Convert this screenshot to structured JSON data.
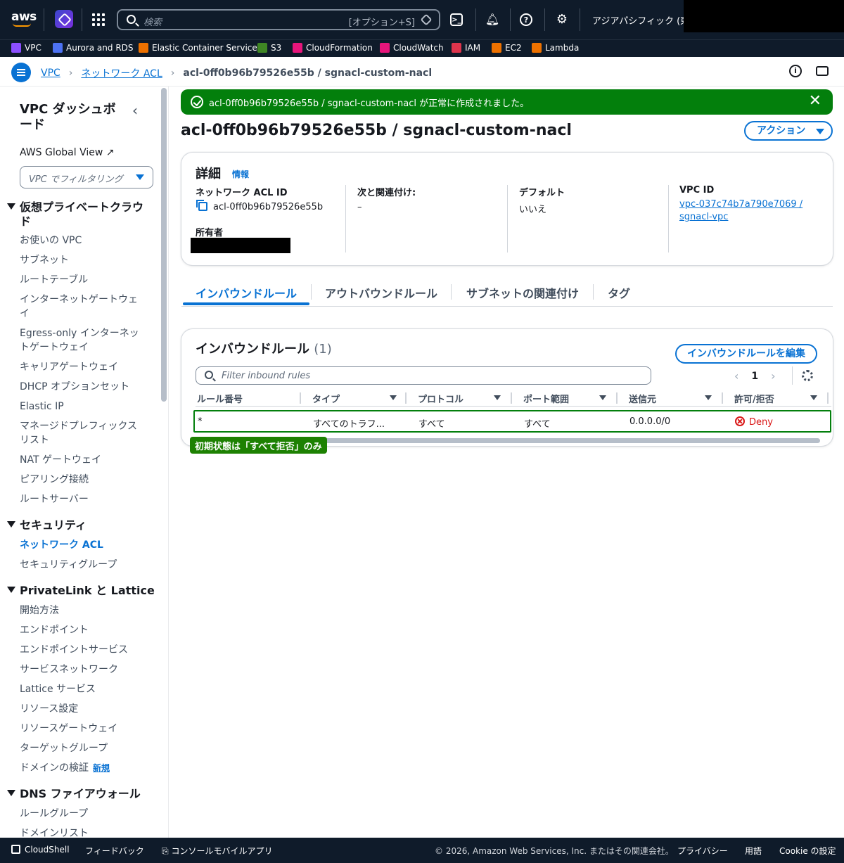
{
  "topnav": {
    "logo": "aws",
    "search_placeholder": "検索",
    "search_hint": "[オプション+S]",
    "region": "アジアパシフィック (東京)"
  },
  "favorites": [
    {
      "label": "VPC",
      "color": "#8c4fff"
    },
    {
      "label": "Aurora and RDS",
      "color": "#4d72f3"
    },
    {
      "label": "Elastic Container Service",
      "color": "#ed7100"
    },
    {
      "label": "S3",
      "color": "#3f8624"
    },
    {
      "label": "CloudFormation",
      "color": "#e7157b"
    },
    {
      "label": "CloudWatch",
      "color": "#e7157b"
    },
    {
      "label": "IAM",
      "color": "#dd344c"
    },
    {
      "label": "EC2",
      "color": "#ed7100"
    },
    {
      "label": "Lambda",
      "color": "#ed7100"
    }
  ],
  "breadcrumb": {
    "items": [
      "VPC",
      "ネットワーク ACL"
    ],
    "current": "acl-0ff0b96b79526e55b / sgnacl-custom-nacl"
  },
  "sidebar": {
    "title": "VPC ダッシュボード",
    "global_view": "AWS Global View",
    "filter_placeholder": "VPC でフィルタリング",
    "sections": [
      {
        "title": "仮想プライベートクラウド",
        "items": [
          "お使いの VPC",
          "サブネット",
          "ルートテーブル",
          "インターネットゲートウェイ",
          "Egress-only インターネットゲートウェイ",
          "キャリアゲートウェイ",
          "DHCP オプションセット",
          "Elastic IP",
          "マネージドプレフィックスリスト",
          "NAT ゲートウェイ",
          "ピアリング接続",
          "ルートサーバー"
        ]
      },
      {
        "title": "セキュリティ",
        "items": [
          "ネットワーク ACL",
          "セキュリティグループ"
        ]
      },
      {
        "title": "PrivateLink と Lattice",
        "items": [
          "開始方法",
          "エンドポイント",
          "エンドポイントサービス",
          "サービスネットワーク",
          "Lattice サービス",
          "リソース設定",
          "リソースゲートウェイ",
          "ターゲットグループ",
          "ドメインの検証"
        ]
      },
      {
        "title": "DNS ファイアウォール",
        "items": [
          "ルールグループ",
          "ドメインリスト"
        ]
      }
    ],
    "new_badge": "新規"
  },
  "flash": {
    "message": "acl-0ff0b96b79526e55b / sgnacl-custom-nacl が正常に作成されました。",
    "color": "#037f0c"
  },
  "page": {
    "title": "acl-0ff0b96b79526e55b / sgnacl-custom-nacl",
    "action_label": "アクション"
  },
  "details": {
    "heading": "詳細",
    "info": "情報",
    "acl_id_label": "ネットワーク ACL ID",
    "acl_id": "acl-0ff0b96b79526e55b",
    "owner_label": "所有者",
    "assoc_label": "次と関連付け:",
    "assoc_value": "–",
    "default_label": "デフォルト",
    "default_value": "いいえ",
    "vpc_label": "VPC ID",
    "vpc_value_1": "vpc-037c74b7a790e7069 /",
    "vpc_value_2": "sgnacl-vpc"
  },
  "tabs": [
    "インバウンドルール",
    "アウトバウンドルール",
    "サブネットの関連付け",
    "タグ"
  ],
  "rules": {
    "heading": "インバウンドルール",
    "count": "(1)",
    "edit_label": "インバウンドルールを編集",
    "filter_placeholder": "Filter inbound rules",
    "page": "1",
    "columns": [
      "ルール番号",
      "タイプ",
      "プロトコル",
      "ポート範囲",
      "送信元",
      "許可/拒否"
    ],
    "rows": [
      {
        "rule": "*",
        "type": "すべてのトラフ...",
        "protocol": "すべて",
        "port": "すべて",
        "source": "0.0.0.0/0",
        "action": "Deny"
      }
    ]
  },
  "annotation": "初期状態は「すべて拒否」のみ",
  "footer": {
    "cloudshell": "CloudShell",
    "feedback": "フィードバック",
    "mobile": "コンソールモバイルアプリ",
    "copyright": "© 2026, Amazon Web Services, Inc. またはその関連会社。",
    "privacy": "プライバシー",
    "terms": "用語",
    "cookie": "Cookie の設定"
  }
}
